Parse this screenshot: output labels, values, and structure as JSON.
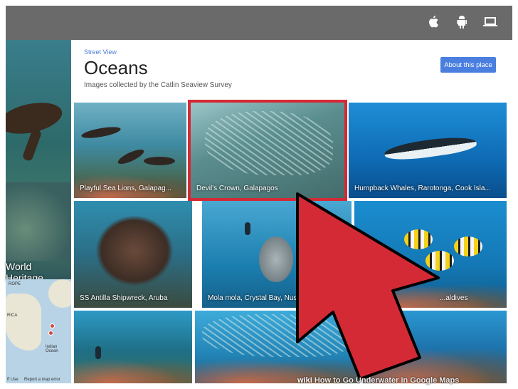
{
  "topbar": {
    "icons": [
      "apple-icon",
      "android-icon",
      "laptop-icon"
    ]
  },
  "left_panel": {
    "world_heritage": "World Heritage",
    "map_labels": {
      "rope": "ROPE",
      "rica": "RICA",
      "indian_ocean": "Indian\nOcean",
      "footer_left": "ff Use",
      "footer_right": "Report a map error"
    }
  },
  "page": {
    "breadcrumb": "Street View",
    "title": "Oceans",
    "subtitle": "Images collected by the Catlin Seaview Survey",
    "about_button": "About this place"
  },
  "gallery": [
    {
      "caption": "Playful Sea Lions, Galapag..."
    },
    {
      "caption": "Devil's Crown, Galapagos"
    },
    {
      "caption": "Humpback Whales, Rarotonga, Cook Isla..."
    },
    {
      "caption": "SS Antilla Shipwreck, Aruba"
    },
    {
      "caption": "Mola mola, Crystal Bay, Nusa Peni..."
    },
    {
      "caption": "...aldives"
    },
    {
      "caption": ""
    },
    {
      "caption": ""
    },
    {
      "caption": ""
    }
  ],
  "annotation": {
    "highlight_color": "#d42a36",
    "arrow_color": "#d42a36"
  },
  "watermark": {
    "wiki": "wiki",
    "text": "How to Go Underwater in Google Maps"
  }
}
